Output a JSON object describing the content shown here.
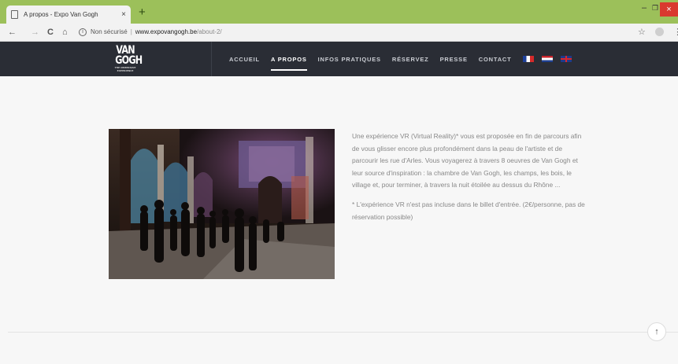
{
  "browser": {
    "tab_title": "A propos - Expo Van Gogh",
    "tab_close": "×",
    "new_tab": "+",
    "minimize": "–",
    "restore": "❐",
    "close": "×",
    "back": "←",
    "forward": "→",
    "reload": "C",
    "home": "⌂",
    "security_label": "Non sécurisé",
    "separator": "|",
    "url_host": "www.expovangogh.be",
    "url_path": "/about-2/",
    "bookmark_icon": "☆",
    "menu_icon": "⋮"
  },
  "site": {
    "logo_line1": "VAN",
    "logo_line2": "GOGH",
    "logo_tagline": "THE IMMERSIVE EXPERIENCE",
    "nav": [
      {
        "label": "ACCUEIL",
        "active": false
      },
      {
        "label": "A PROPOS",
        "active": true
      },
      {
        "label": "INFOS PRATIQUES",
        "active": false
      },
      {
        "label": "RÉSERVEZ",
        "active": false
      },
      {
        "label": "PRESSE",
        "active": false
      },
      {
        "label": "CONTACT",
        "active": false
      }
    ],
    "languages": [
      "fr-flag-icon",
      "nl-flag-icon",
      "gb-flag-icon"
    ]
  },
  "main": {
    "paragraph1": "Une expérience VR (Virtual Reality)* vous est proposée en fin de parcours afin de vous glisser encore plus profondément dans la peau de l'artiste et de parcourir les rue d'Arles. Vous voyagerez à travers 8 oeuvres de Van Gogh et leur source d'inspiration : la chambre de Van Gogh, les champs, les bois, le village et, pour terminer, à travers la nuit étoilée au dessus du Rhône ...",
    "paragraph2": "* L'expérience VR n'est pas incluse dans le billet d'entrée. (2€/personne, pas de réservation possible)",
    "scroll_top_icon": "↑"
  },
  "colors": {
    "tabbar": "#9cc05a",
    "header": "#2a2d35",
    "content_bg": "#f7f7f7",
    "body_text": "#888888"
  }
}
